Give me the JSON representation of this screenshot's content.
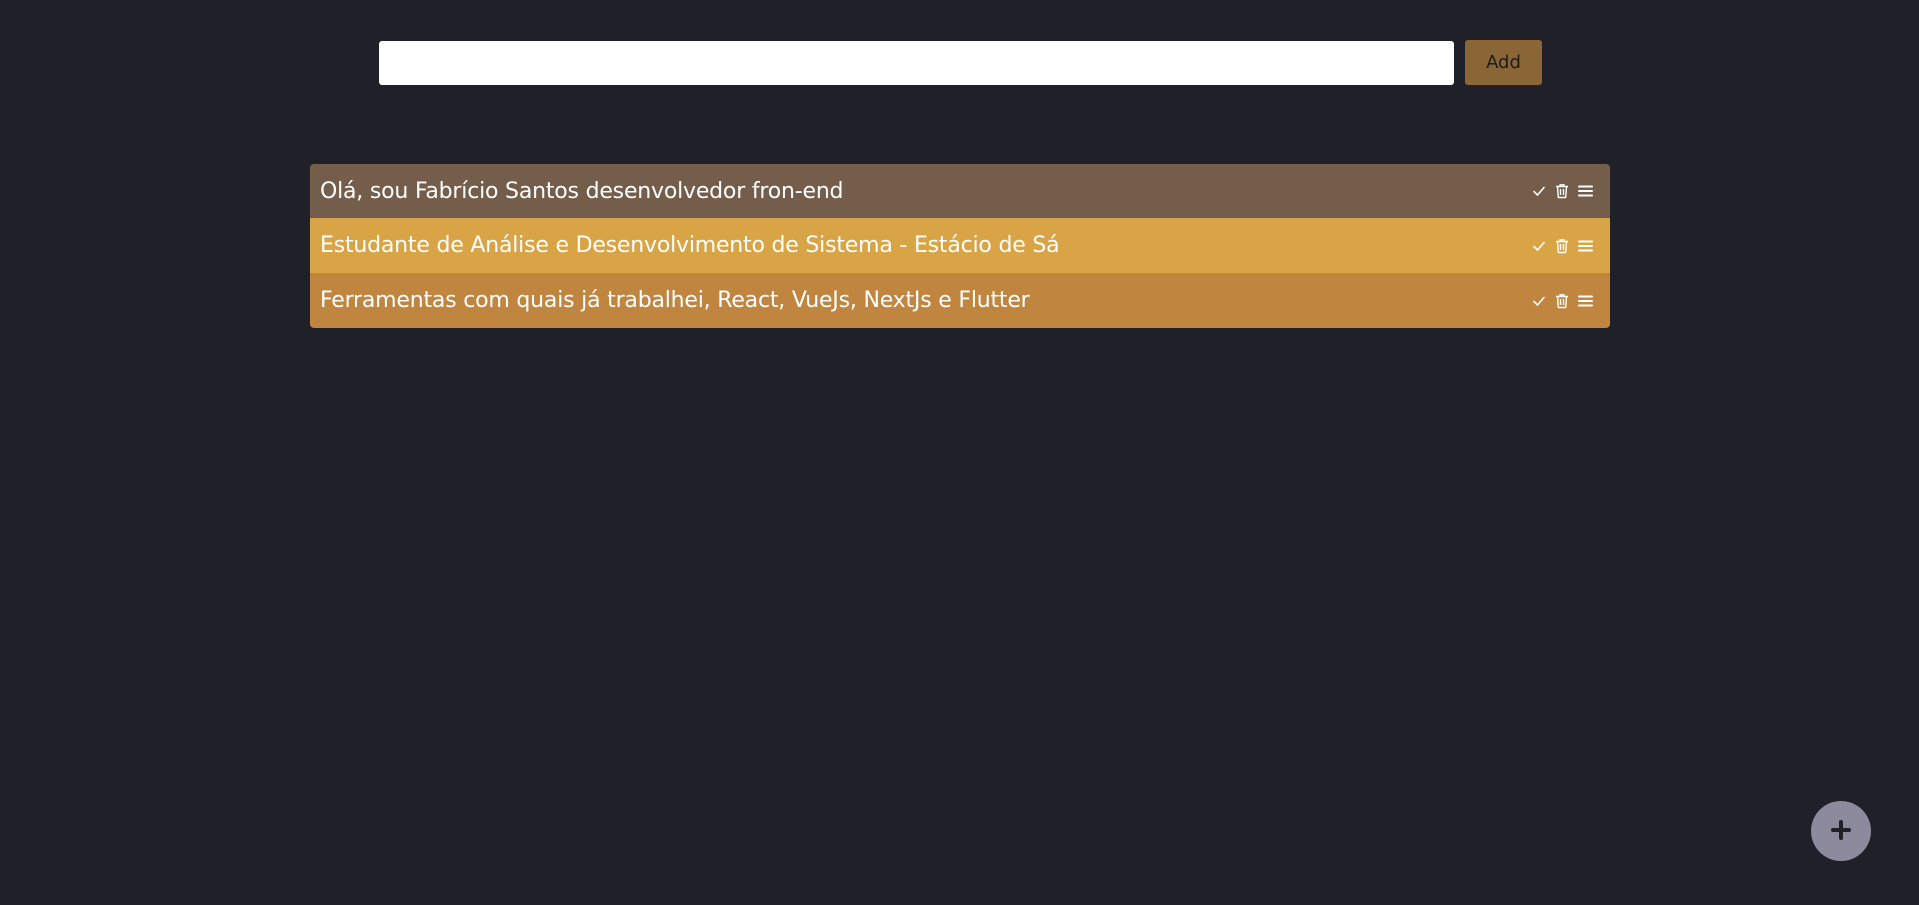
{
  "add_form": {
    "input_value": "",
    "input_placeholder": "",
    "add_label": "Add"
  },
  "tasks": [
    {
      "text": "Olá, sou Fabrício Santos desenvolvedor fron-end",
      "color": "#745d4a"
    },
    {
      "text": "Estudante de Análise e Desenvolvimento de Sistema - Estácio de Sá",
      "color": "#d8a446"
    },
    {
      "text": "Ferramentas com quais já trabalhei, React, VueJs, NextJs e Flutter",
      "color": "#c0853f"
    }
  ],
  "task_actions": [
    "check-icon",
    "trash-icon",
    "menu-icon"
  ],
  "fab": {
    "icon": "plus-icon"
  },
  "colors": {
    "background": "#1f2028",
    "add_button": "#8a6636",
    "fab": "#8d8a9e"
  }
}
